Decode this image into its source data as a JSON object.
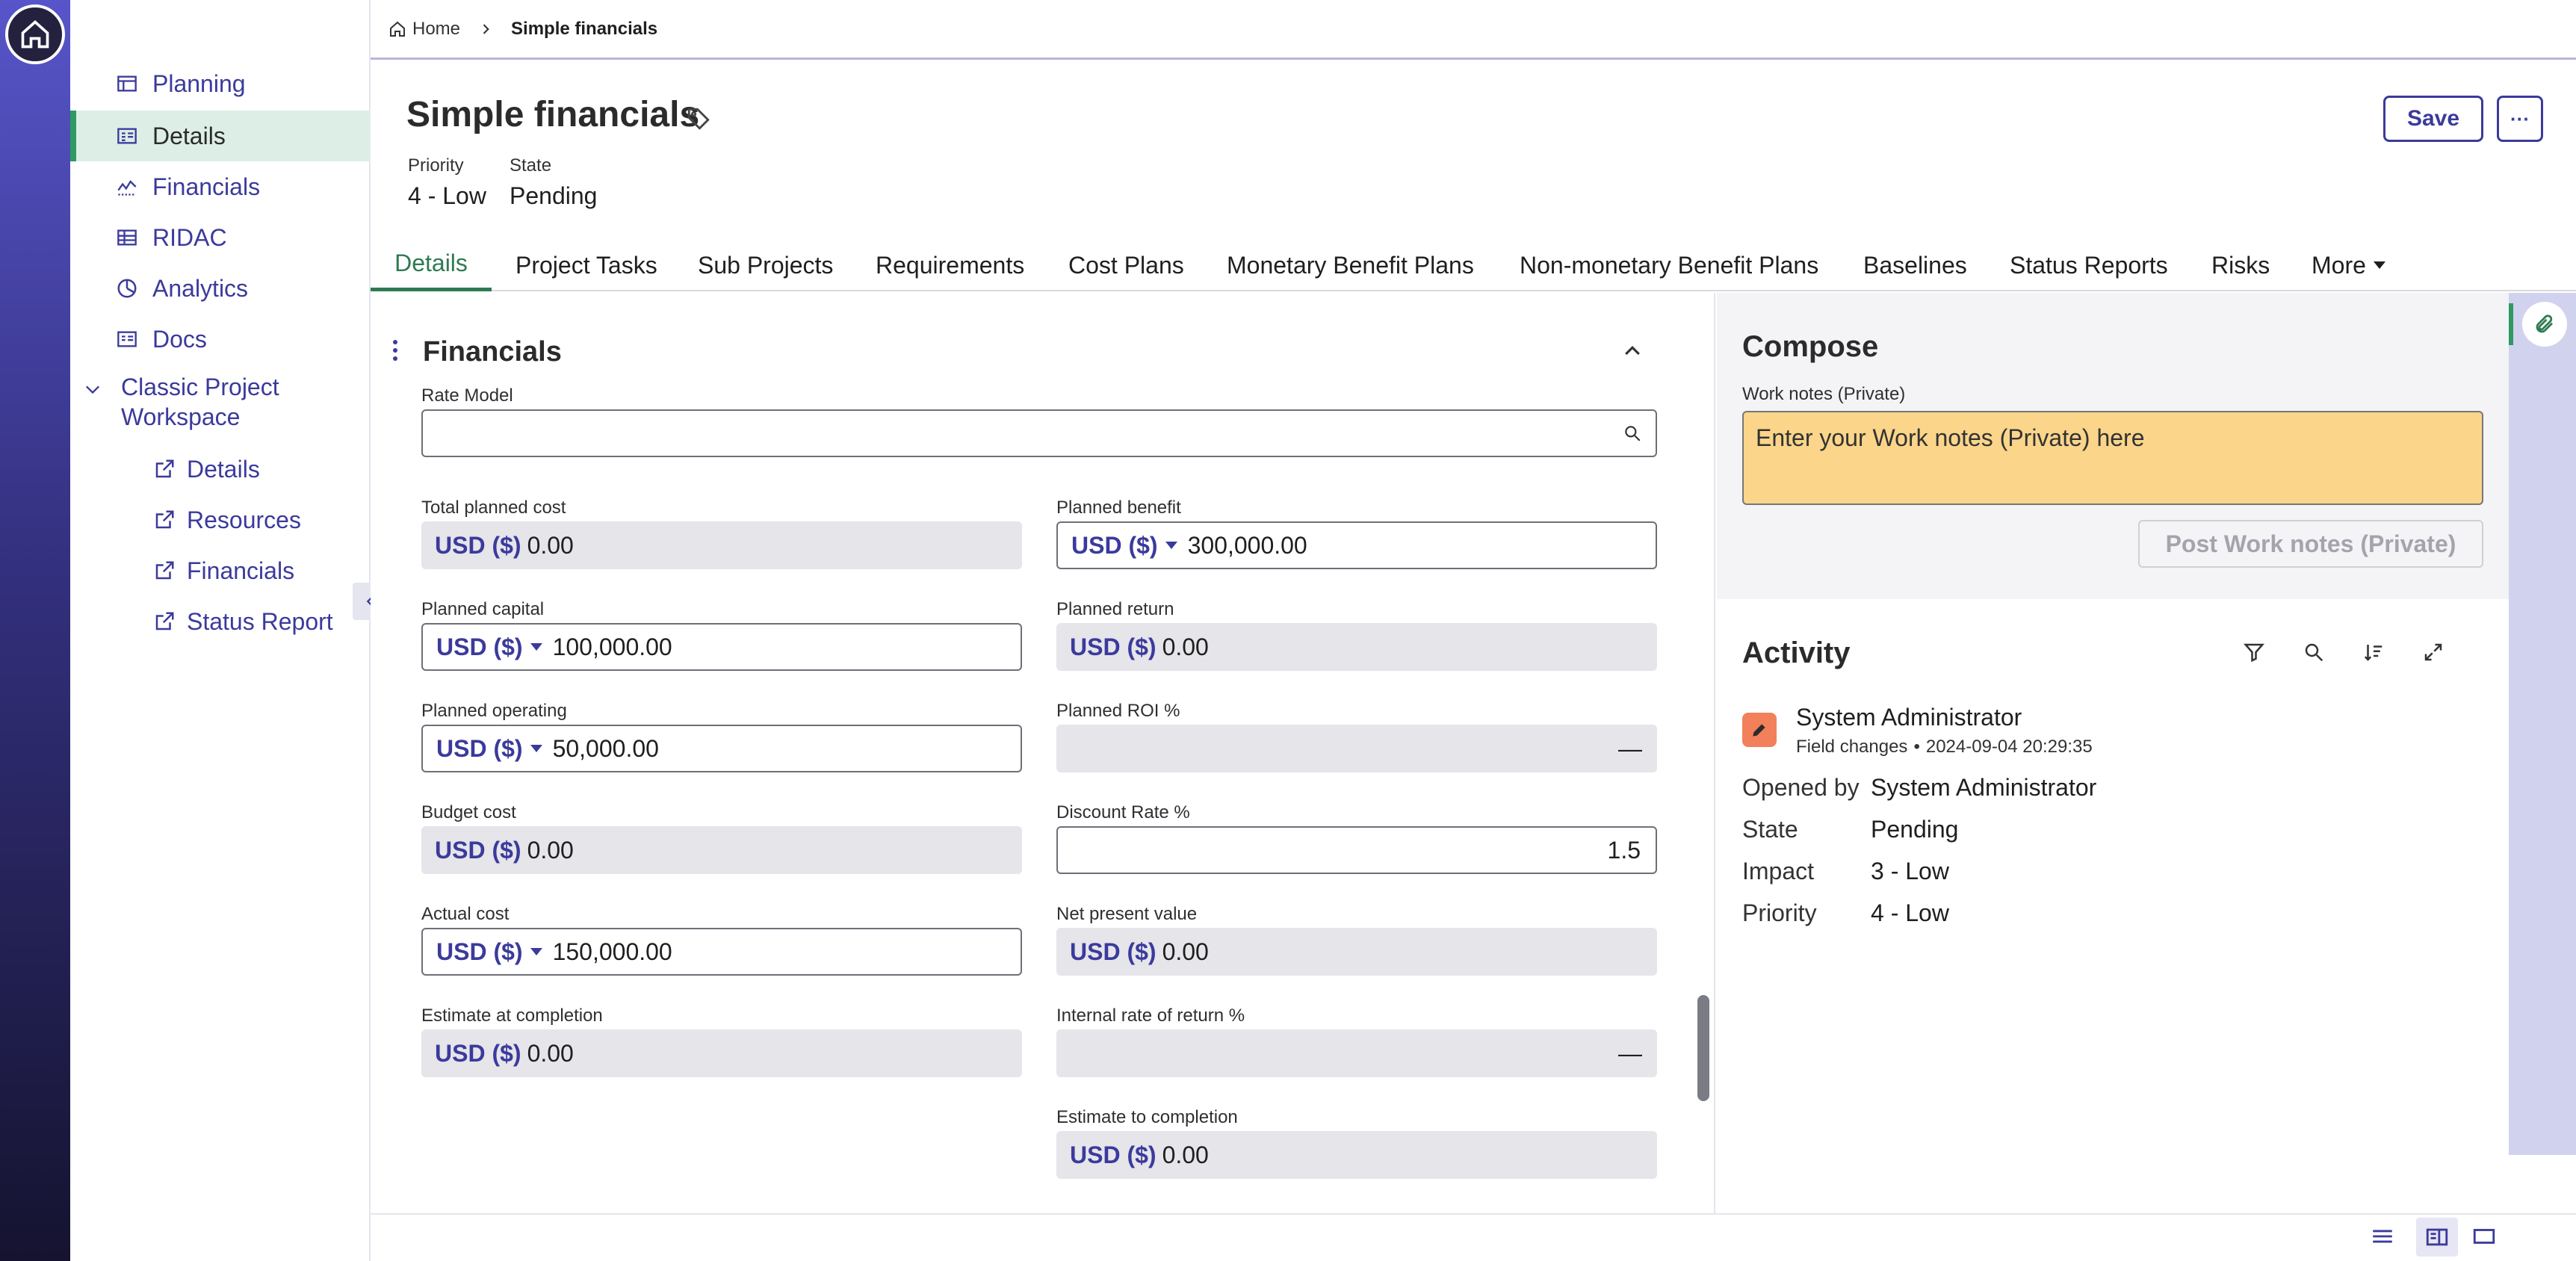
{
  "breadcrumb": {
    "home": "Home",
    "current": "Simple financials"
  },
  "sidenav": {
    "items": [
      {
        "label": "Planning",
        "icon": "planning-icon"
      },
      {
        "label": "Details",
        "icon": "details-icon",
        "active": true
      },
      {
        "label": "Financials",
        "icon": "financials-icon"
      },
      {
        "label": "RIDAC",
        "icon": "table-icon"
      },
      {
        "label": "Analytics",
        "icon": "analytics-icon"
      },
      {
        "label": "Docs",
        "icon": "docs-icon"
      }
    ],
    "group": {
      "label_line1": "Classic Project",
      "label_line2": "Workspace"
    },
    "sub_items": [
      {
        "label": "Details",
        "icon": "external-link-icon"
      },
      {
        "label": "Resources",
        "icon": "external-link-icon"
      },
      {
        "label": "Financials",
        "icon": "external-link-icon"
      },
      {
        "label": "Status Report",
        "icon": "external-link-icon"
      }
    ]
  },
  "header": {
    "title": "Simple financials",
    "save_label": "Save",
    "more_label": "···",
    "priority_label": "Priority",
    "priority_value": "4 - Low",
    "state_label": "State",
    "state_value": "Pending"
  },
  "tabs": [
    {
      "label": "Details",
      "active": true
    },
    {
      "label": "Project Tasks"
    },
    {
      "label": "Sub Projects"
    },
    {
      "label": "Requirements"
    },
    {
      "label": "Cost Plans"
    },
    {
      "label": "Monetary Benefit Plans"
    },
    {
      "label": "Non-monetary Benefit Plans"
    },
    {
      "label": "Baselines"
    },
    {
      "label": "Status Reports"
    },
    {
      "label": "Risks"
    },
    {
      "label": "More"
    }
  ],
  "financials": {
    "section_title": "Financials",
    "rate_model_label": "Rate Model",
    "rate_model_value": "",
    "currency": "USD ($)",
    "left": [
      {
        "label": "Total planned cost",
        "value": "0.00",
        "editable": false
      },
      {
        "label": "Planned capital",
        "value": "100,000.00",
        "editable": true
      },
      {
        "label": "Planned operating",
        "value": "50,000.00",
        "editable": true
      },
      {
        "label": "Budget cost",
        "value": "0.00",
        "editable": false
      },
      {
        "label": "Actual cost",
        "value": "150,000.00",
        "editable": true
      },
      {
        "label": "Estimate at completion",
        "value": "0.00",
        "editable": false
      }
    ],
    "right": [
      {
        "label": "Planned benefit",
        "value": "300,000.00",
        "editable": true
      },
      {
        "label": "Planned return",
        "value": "0.00",
        "editable": false
      },
      {
        "label": "Planned ROI %",
        "value": "—",
        "editable": false,
        "plain": true
      },
      {
        "label": "Discount Rate %",
        "value": "1.5",
        "editable": true,
        "plain": true
      },
      {
        "label": "Net present value",
        "value": "0.00",
        "editable": false
      },
      {
        "label": "Internal rate of return %",
        "value": "—",
        "editable": false,
        "plain": true
      },
      {
        "label": "Estimate to completion",
        "value": "0.00",
        "editable": false
      }
    ]
  },
  "compose": {
    "title": "Compose",
    "work_notes_label": "Work notes (Private)",
    "work_notes_placeholder": "Enter your Work notes (Private) here",
    "post_label": "Post Work notes (Private)"
  },
  "activity": {
    "title": "Activity",
    "entry": {
      "user": "System Administrator",
      "kind": "Field changes",
      "timestamp": "2024-09-04 20:29:35",
      "fields": [
        {
          "key": "Opened by",
          "value": "System Administrator"
        },
        {
          "key": "State",
          "value": "Pending"
        },
        {
          "key": "Impact",
          "value": "3 - Low"
        },
        {
          "key": "Priority",
          "value": "4 - Low"
        }
      ]
    }
  },
  "colors": {
    "accent": "#3b3a9c",
    "active_green": "#2e7a51",
    "note_bg": "#fbd58a",
    "activity_icon": "#f2805b"
  }
}
